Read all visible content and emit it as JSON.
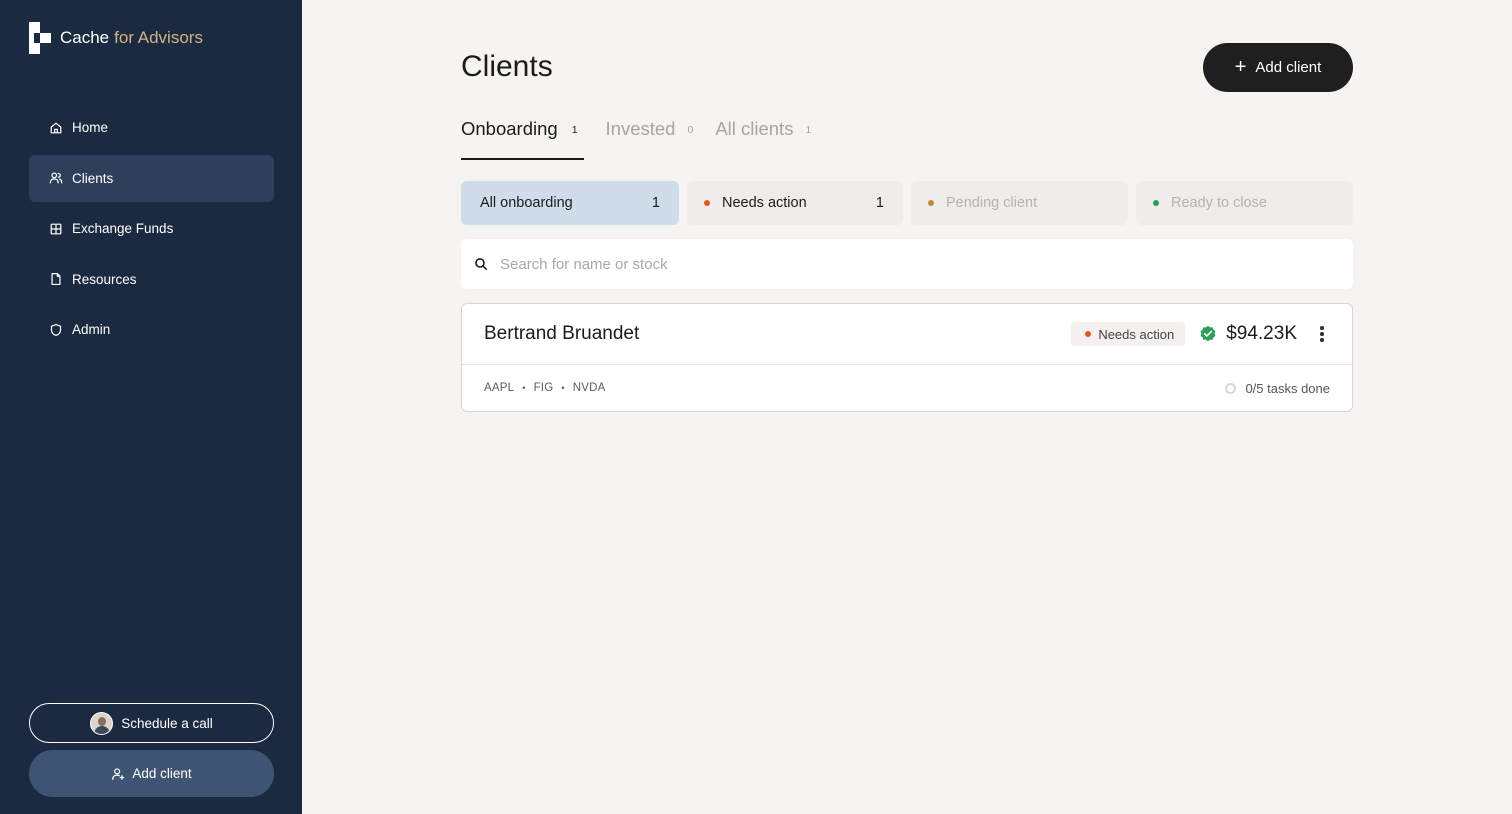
{
  "brand": {
    "name": "Cache",
    "accent": "for Advisors"
  },
  "sidebar": {
    "items": [
      {
        "label": "Home",
        "icon": "home-icon"
      },
      {
        "label": "Clients",
        "icon": "users-icon",
        "active": true
      },
      {
        "label": "Exchange Funds",
        "icon": "grid-icon"
      },
      {
        "label": "Resources",
        "icon": "document-icon"
      },
      {
        "label": "Admin",
        "icon": "shield-icon"
      }
    ],
    "schedule_label": "Schedule a call",
    "add_client_label": "Add client"
  },
  "main": {
    "title": "Clients",
    "add_client_label": "Add client",
    "tabs": [
      {
        "label": "Onboarding",
        "count": "1",
        "active": true
      },
      {
        "label": "Invested",
        "count": "0"
      },
      {
        "label": "All clients",
        "count": "1"
      }
    ],
    "filters": [
      {
        "label": "All onboarding",
        "count": "1",
        "active": true
      },
      {
        "label": "Needs action",
        "count": "1",
        "dot_color": "#e2542a"
      },
      {
        "label": "Pending client",
        "count": "",
        "dot_color": "#b8894a",
        "disabled": true
      },
      {
        "label": "Ready to close",
        "count": "",
        "dot_color": "#2e9e5b",
        "disabled": true
      }
    ],
    "search": {
      "placeholder": "Search for name or stock"
    },
    "clients": [
      {
        "name": "Bertrand Bruandet",
        "status": "Needs action",
        "amount": "$94.23K",
        "tickers": [
          "AAPL",
          "FIG",
          "NVDA"
        ],
        "tasks": "0/5 tasks done"
      }
    ]
  },
  "colors": {
    "sidebar_bg": "#1b2a41",
    "accent_gold": "#d4b483",
    "needs_action": "#e2542a",
    "pending": "#b8894a",
    "ready": "#2e9e5b",
    "verified": "#2e9e5b"
  }
}
